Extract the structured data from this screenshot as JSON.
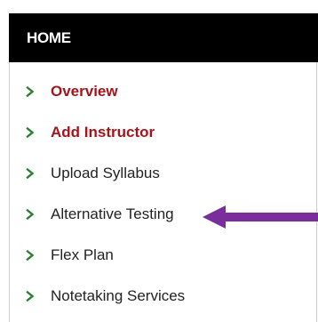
{
  "header": {
    "title": "HOME"
  },
  "nav": {
    "items": [
      {
        "label": "Overview",
        "active": true
      },
      {
        "label": "Add Instructor",
        "active": true
      },
      {
        "label": "Upload Syllabus",
        "active": false
      },
      {
        "label": "Alternative Testing",
        "active": false
      },
      {
        "label": "Flex Plan",
        "active": false
      },
      {
        "label": "Notetaking Services",
        "active": false
      }
    ]
  },
  "colors": {
    "header_bg": "#000000",
    "active_link": "#a3151b",
    "chevron": "#2e7d32",
    "annotation_arrow": "#7a2e9c"
  },
  "icons": {
    "nav_bullet": "chevron-right-icon",
    "annotation": "arrow-left-icon"
  }
}
